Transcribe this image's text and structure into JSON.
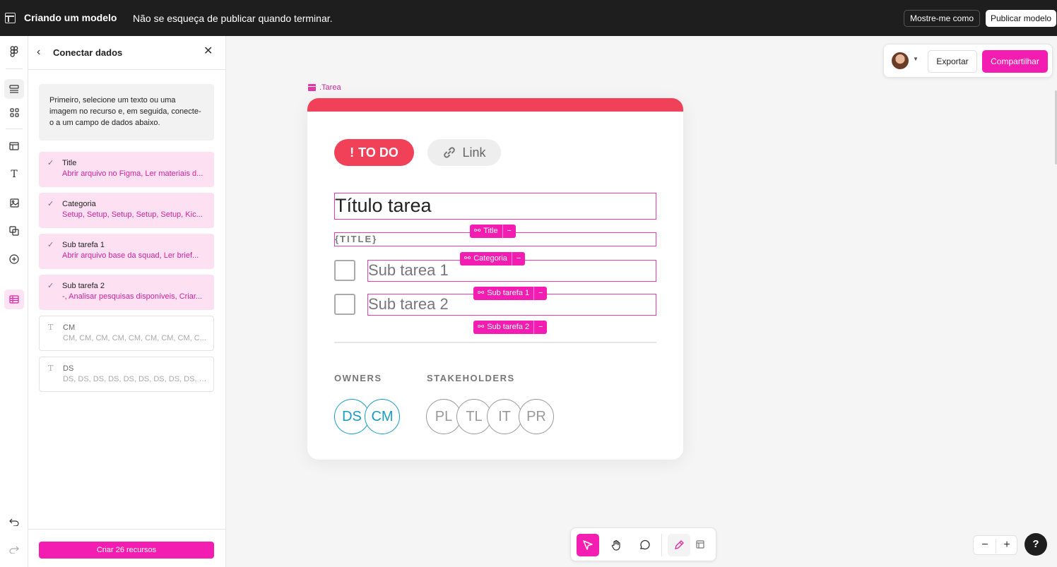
{
  "topbar": {
    "app_title": "Criando um modelo",
    "message": "Não se esqueça de publicar quando terminar.",
    "show_me_label": "Mostre-me como",
    "publish_label": "Publicar modelo"
  },
  "toolbar": {
    "icons": [
      "figma-logo-icon",
      "layers-icon",
      "assets-icon",
      "template-icon",
      "text-icon",
      "image-icon",
      "shapes-icon",
      "plugins-icon",
      "data-table-icon",
      "undo-icon",
      "redo-icon"
    ]
  },
  "panel": {
    "title": "Conectar dados",
    "info": "Primeiro, selecione um texto ou uma imagem no recurso e, em seguida, conecte-o a um campo de dados abaixo.",
    "fields": [
      {
        "name": "Title",
        "values": "Abrir arquivo no Figma, Ler materiais d...",
        "connected": true
      },
      {
        "name": "Categoria",
        "values": "Setup, Setup, Setup, Setup, Setup, Kic...",
        "connected": true
      },
      {
        "name": "Sub tarefa 1",
        "values": "Abrir arquivo base da squad, Ler brief...",
        "connected": true
      },
      {
        "name": "Sub tarefa 2",
        "values": "-, Analisar pesquisas disponíveis, Criar...",
        "connected": true
      },
      {
        "name": "CM",
        "values": "CM, CM, CM, CM, CM, CM, CM, CM, C...",
        "connected": false
      },
      {
        "name": "DS",
        "values": "DS, DS, DS, DS, DS, DS, DS, DS, DS, D...",
        "connected": false
      }
    ],
    "create_label": "Criar 26 recursos"
  },
  "share": {
    "export_label": "Exportar",
    "share_label": "Compartilhar"
  },
  "canvas": {
    "component_label": ".Tarea",
    "card": {
      "status": "TO DO",
      "status_mark": "!",
      "link": "Link",
      "title": "Título tarea",
      "title_placeholder": "{TITLE}",
      "subtask1": "Sub tarea 1",
      "subtask2": "Sub tarea 2",
      "owners_label": "OWNERS",
      "stakeholders_label": "STAKEHOLDERS",
      "owners": [
        "DS",
        "CM"
      ],
      "stakeholders": [
        "PL",
        "TL",
        "IT",
        "PR"
      ]
    },
    "tags": {
      "title": "Title",
      "categoria": "Categoria",
      "sub1": "Sub tarefa 1",
      "sub2": "Sub tarefa 2",
      "minus": "−"
    }
  },
  "zoom": {
    "minus": "−",
    "plus": "+"
  },
  "help_label": "?",
  "colors": {
    "accent": "#f31eb1",
    "todo_red": "#f04158",
    "owner_blue": "#199cc4",
    "topbar": "#1e1e1e"
  }
}
